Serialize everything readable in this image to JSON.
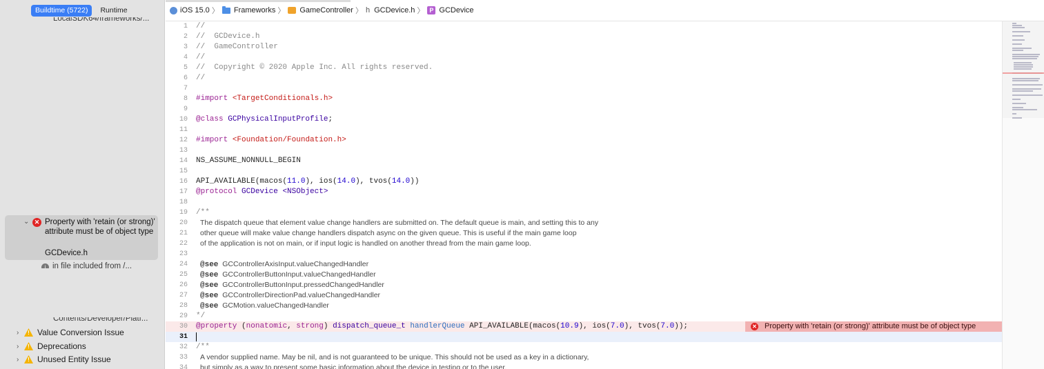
{
  "navigator": {
    "scopes": [
      "Buildtime (5722)",
      "Runtime"
    ],
    "issue_top_cut": "LocalSDK64/frameworks/...",
    "selected_issue": {
      "message": "Property with 'retain (or strong)' attribute must be of object type",
      "file": "GCDevice.h"
    },
    "included_from": "in file included from /...",
    "contents_cut": "Contents/Developer/Platf...",
    "groups": [
      {
        "label": "Value Conversion Issue"
      },
      {
        "label": "Deprecations"
      },
      {
        "label": "Unused Entity Issue"
      }
    ]
  },
  "jumpbar": {
    "crumbs": [
      "iOS 15.0",
      "Frameworks",
      "GameController",
      "GCDevice.h",
      "GCDevice"
    ]
  },
  "editor": {
    "line_numbers": [
      "1",
      "2",
      "3",
      "4",
      "5",
      "6",
      "7",
      "8",
      "9",
      "10",
      "11",
      "12",
      "13",
      "14",
      "15",
      "16",
      "17",
      "18",
      "19",
      "20",
      "21",
      "22",
      "23",
      "24",
      "25",
      "26",
      "27",
      "28",
      "29",
      "30",
      "31",
      "32",
      "33",
      "34"
    ],
    "lines": {
      "l1": "//",
      "l2": "//  GCDevice.h",
      "l3": "//  GameController",
      "l4": "//",
      "l5": "//  Copyright © 2020 Apple Inc. All rights reserved.",
      "l6": "//",
      "l8_kw": "#import",
      "l8_str": "<TargetConditionals.h>",
      "l10_kw": "@class",
      "l10_tp": "GCPhysicalInputProfile",
      "l10_end": ";",
      "l12_kw": "#import",
      "l12_str": "<Foundation/Foundation.h>",
      "l14": "NS_ASSUME_NONNULL_BEGIN",
      "l16_a": "API_AVAILABLE(macos(",
      "l16_n1": "11.0",
      "l16_b": "), ios(",
      "l16_n2": "14.0",
      "l16_c": "), tvos(",
      "l16_n3": "14.0",
      "l16_d": "))",
      "l17_kw": "@protocol",
      "l17_tp": "GCDevice",
      "l17_str": "<NSObject>",
      "l19": "/**",
      "l20": "The dispatch queue that element value change handlers are submitted on. The default queue is main, and setting this to any",
      "l21": "other queue will make value change handlers dispatch async on the given queue. This is useful if the main game loop",
      "l22": "of the application is not on main, or if input logic is handled on another thread from the main game loop.",
      "see_tag": "@see",
      "l24": "GCControllerAxisInput.valueChangedHandler",
      "l25": "GCControllerButtonInput.valueChangedHandler",
      "l26": "GCControllerButtonInput.pressedChangedHandler",
      "l27": "GCControllerDirectionPad.valueChangedHandler",
      "l28": "GCMotion.valueChangedHandler",
      "l29": "*/",
      "l30_kw": "@property",
      "l30_a": "(",
      "l30_kw2": "nonatomic",
      "l30_b": ", ",
      "l30_kw3": "strong",
      "l30_c": ") ",
      "l30_tp": "dispatch_queue_t",
      "l30_d": " ",
      "l30_tp2": "handlerQueue",
      "l30_e": " API_AVAILABLE(macos(",
      "l30_n1": "10.9",
      "l30_f": "), ios(",
      "l30_n2": "7.0",
      "l30_g": "), tvos(",
      "l30_n3": "7.0",
      "l30_h": "));",
      "l32": "/**",
      "l33": "A vendor supplied name. May be nil, and is not guaranteed to be unique. This should not be used as a key in a dictionary,",
      "l34": "but simply as a way to present some basic information about the device in testing or to the user."
    },
    "error_banner": "Property with 'retain (or strong)' attribute must be of object type"
  }
}
